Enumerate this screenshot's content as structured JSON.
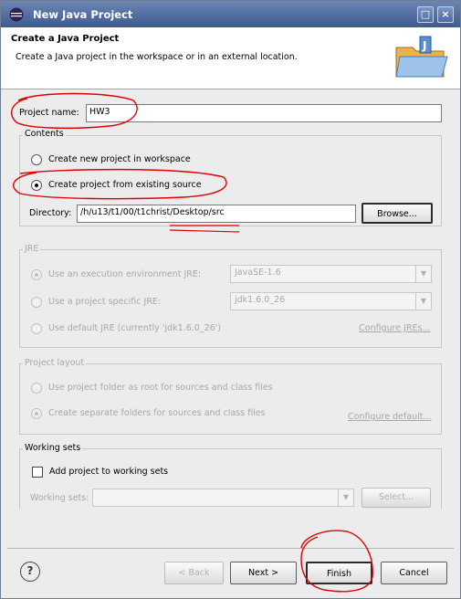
{
  "window": {
    "title": "New Java Project"
  },
  "header": {
    "title": "Create a Java Project",
    "description": "Create a Java project in the workspace or in an external location."
  },
  "project_name": {
    "label": "Project name:",
    "value": "HW3"
  },
  "contents": {
    "label": "Contents",
    "option_new": "Create new project in workspace",
    "option_existing": "Create project from existing source",
    "selected": "existing",
    "directory_label": "Directory:",
    "directory_value": "/h/u13/t1/00/t1christ/Desktop/src",
    "browse_label": "Browse..."
  },
  "jre": {
    "label": "JRE",
    "option_env": "Use an execution environment JRE:",
    "env_value": "JavaSE-1.6",
    "option_specific": "Use a project specific JRE:",
    "specific_value": "jdk1.6.0_26",
    "option_default": "Use default JRE (currently 'jdk1.6.0_26')",
    "configure_link": "Configure JREs..."
  },
  "project_layout": {
    "label": "Project layout",
    "option_root": "Use project folder as root for sources and class files",
    "option_separate": "Create separate folders for sources and class files",
    "configure_link": "Configure default..."
  },
  "working_sets": {
    "label": "Working sets",
    "add_label": "Add project to working sets",
    "sets_label": "Working sets:",
    "select_label": "Select..."
  },
  "footer": {
    "help_icon": "?",
    "back_label": "< Back",
    "next_label": "Next >",
    "finish_label": "Finish",
    "cancel_label": "Cancel"
  },
  "colors": {
    "title_bar": "#4a66a0",
    "annotation": "#e00000"
  }
}
